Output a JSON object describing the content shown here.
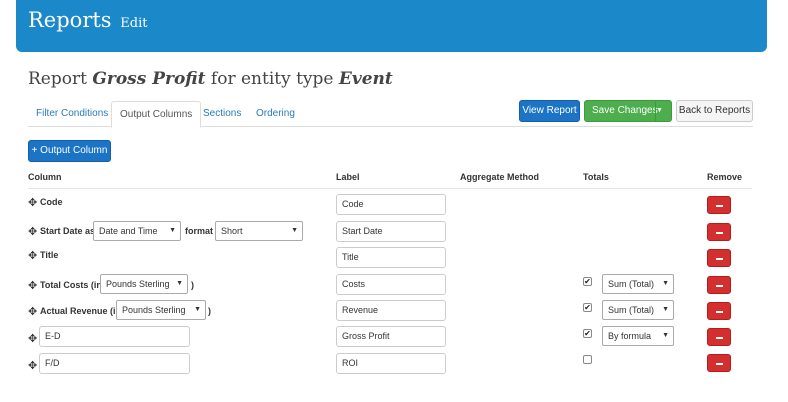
{
  "header": {
    "title": "Reports",
    "edit": "Edit"
  },
  "heading": {
    "prefix": "Report",
    "name": "Gross Profit",
    "middle": "for entity type",
    "entity": "Event"
  },
  "tabs": [
    "Filter Conditions",
    "Output Columns",
    "Sections",
    "Ordering"
  ],
  "active_tab": "Output Columns",
  "buttons": {
    "view": "View Report",
    "save": "Save Changes",
    "back": "Back to Reports",
    "add_column": "+ Output Column"
  },
  "columns": [
    "Column",
    "Label",
    "Aggregate Method",
    "Totals",
    "Remove"
  ],
  "rows": [
    {
      "label": "Code",
      "value": "Code"
    },
    {
      "label": "Start Date as",
      "select1": "Date and Time",
      "mid": "format",
      "select2": "Short",
      "value": "Start Date"
    },
    {
      "label": "Title",
      "value": "Title"
    },
    {
      "label": "Total Costs (in",
      "select1": "Pounds Sterling",
      "suffix": ")",
      "value": "Costs",
      "checked": "✔",
      "total": "Sum (Total)"
    },
    {
      "label": "Actual Revenue (in",
      "select1": "Pounds Sterling",
      "suffix": ")",
      "value": "Revenue",
      "checked": "✔",
      "total": "Sum (Total)"
    },
    {
      "expr": "E-D",
      "value": "Gross Profit",
      "checked": "✔",
      "total": "By formula"
    },
    {
      "expr": "F/D",
      "value": "ROI",
      "checked": ""
    }
  ],
  "icons": {
    "move": "move-icon",
    "caret": "caret-down-icon",
    "remove": "minus-icon"
  }
}
